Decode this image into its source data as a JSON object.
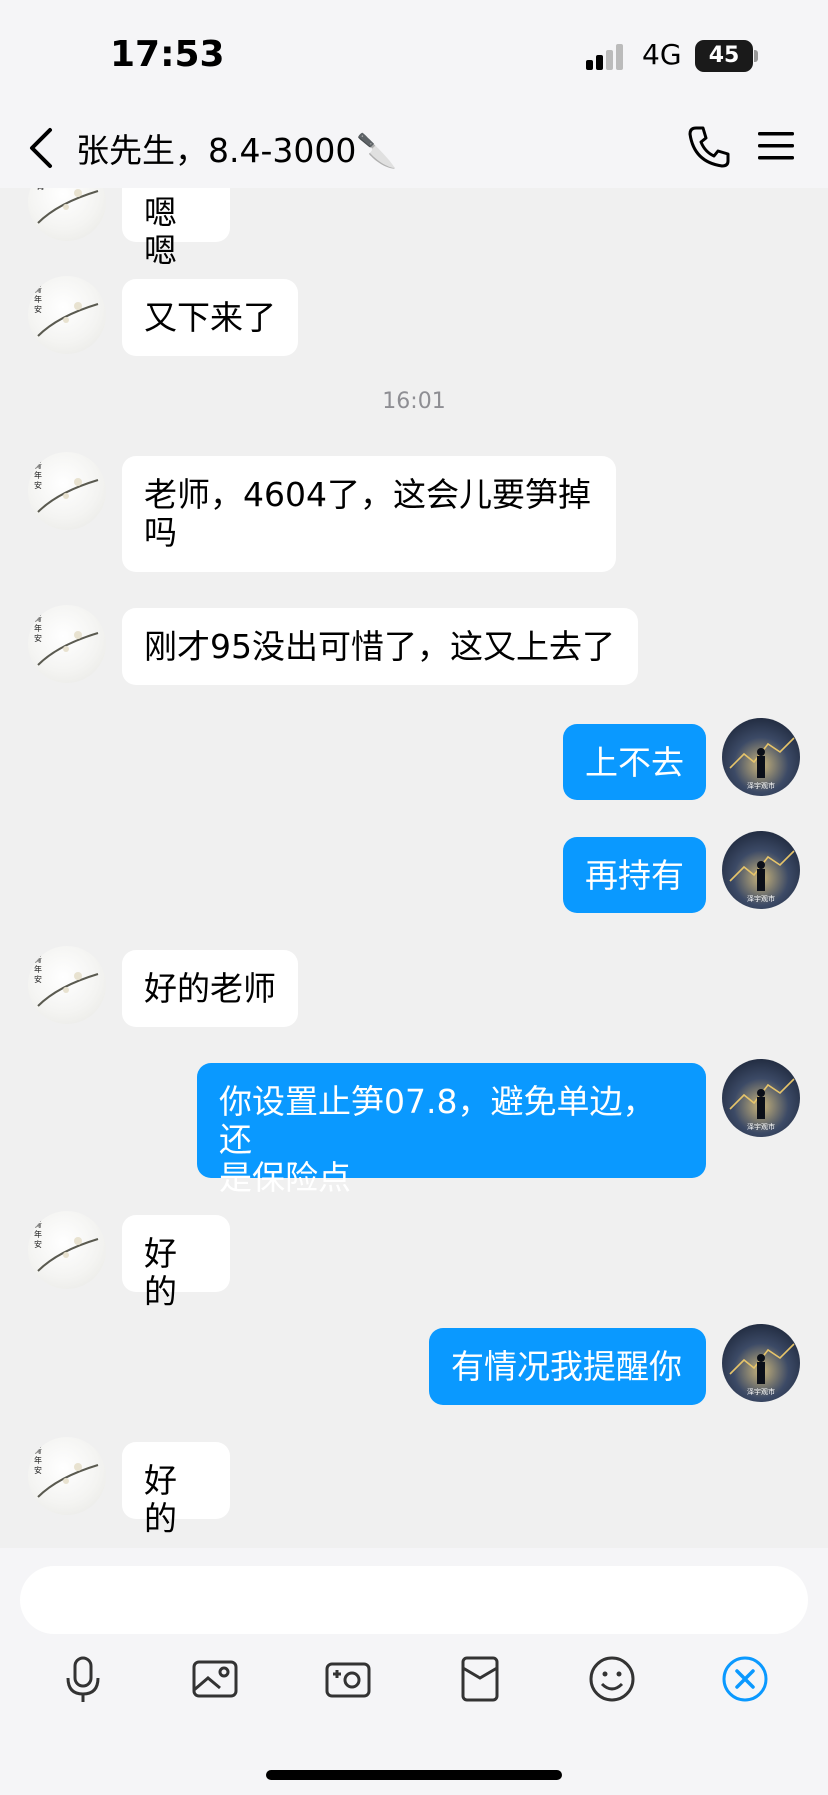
{
  "status_bar": {
    "time": "17:53",
    "network": "4G",
    "battery": "45"
  },
  "header": {
    "title": "张先生，8.4-3000🔪"
  },
  "timestamp": "16:01",
  "messages": [
    {
      "side": "in",
      "text": "嗯嗯"
    },
    {
      "side": "in",
      "text": "又下来了"
    },
    {
      "side": "in",
      "text": "老师，4604了，这会儿要笋掉\n吗"
    },
    {
      "side": "in",
      "text": "刚才95没出可惜了，这又上去了"
    },
    {
      "side": "out",
      "text": "上不去"
    },
    {
      "side": "out",
      "text": "再持有"
    },
    {
      "side": "in",
      "text": "好的老师"
    },
    {
      "side": "out",
      "text": "你设置止笋07.8，避免单边，还\n是保险点"
    },
    {
      "side": "in",
      "text": "好的"
    },
    {
      "side": "out",
      "text": "有情况我提醒你"
    },
    {
      "side": "in",
      "text": "好的"
    }
  ],
  "avatars": {
    "contact_caption": "青年安",
    "self_caption": "泽宇观市"
  },
  "input": {
    "placeholder": ""
  },
  "toolbar": {
    "icons": [
      "microphone-icon",
      "image-icon",
      "camera-icon",
      "red-packet-icon",
      "emoji-icon",
      "plus-icon"
    ]
  },
  "colors": {
    "outgoing_bubble": "#0a99ff",
    "incoming_bubble": "#ffffff",
    "background": "#f0f0f0",
    "accent": "#0a99ff"
  }
}
